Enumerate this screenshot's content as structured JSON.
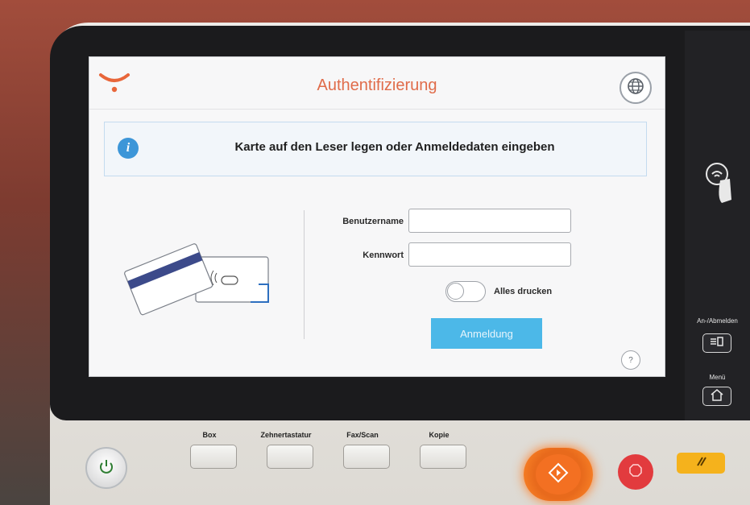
{
  "screen": {
    "title": "Authentifizierung",
    "info_message": "Karte auf den Leser legen oder Anmeldedaten eingeben",
    "username": {
      "label": "Benutzername",
      "value": "",
      "placeholder": ""
    },
    "password": {
      "label": "Kennwort",
      "value": "",
      "placeholder": ""
    },
    "print_all": {
      "label": "Alles drucken",
      "on": false
    },
    "login_button": "Anmeldung",
    "help_label": "?",
    "info_icon": "i"
  },
  "hardware": {
    "side_keys": [
      {
        "label": "An-/Abmelden",
        "icon": "login-logout-icon"
      },
      {
        "label": "Menü",
        "icon": "home-icon"
      }
    ],
    "bottom_keys": [
      "Box",
      "Zehnertastatur",
      "Fax/Scan",
      "Kopie"
    ]
  },
  "colors": {
    "title": "#e06c4a",
    "login_button": "#4cb8e8",
    "info_icon": "#3d96d8",
    "start": "#f37022",
    "stop": "#e23b3e",
    "reset": "#f5b21c"
  }
}
